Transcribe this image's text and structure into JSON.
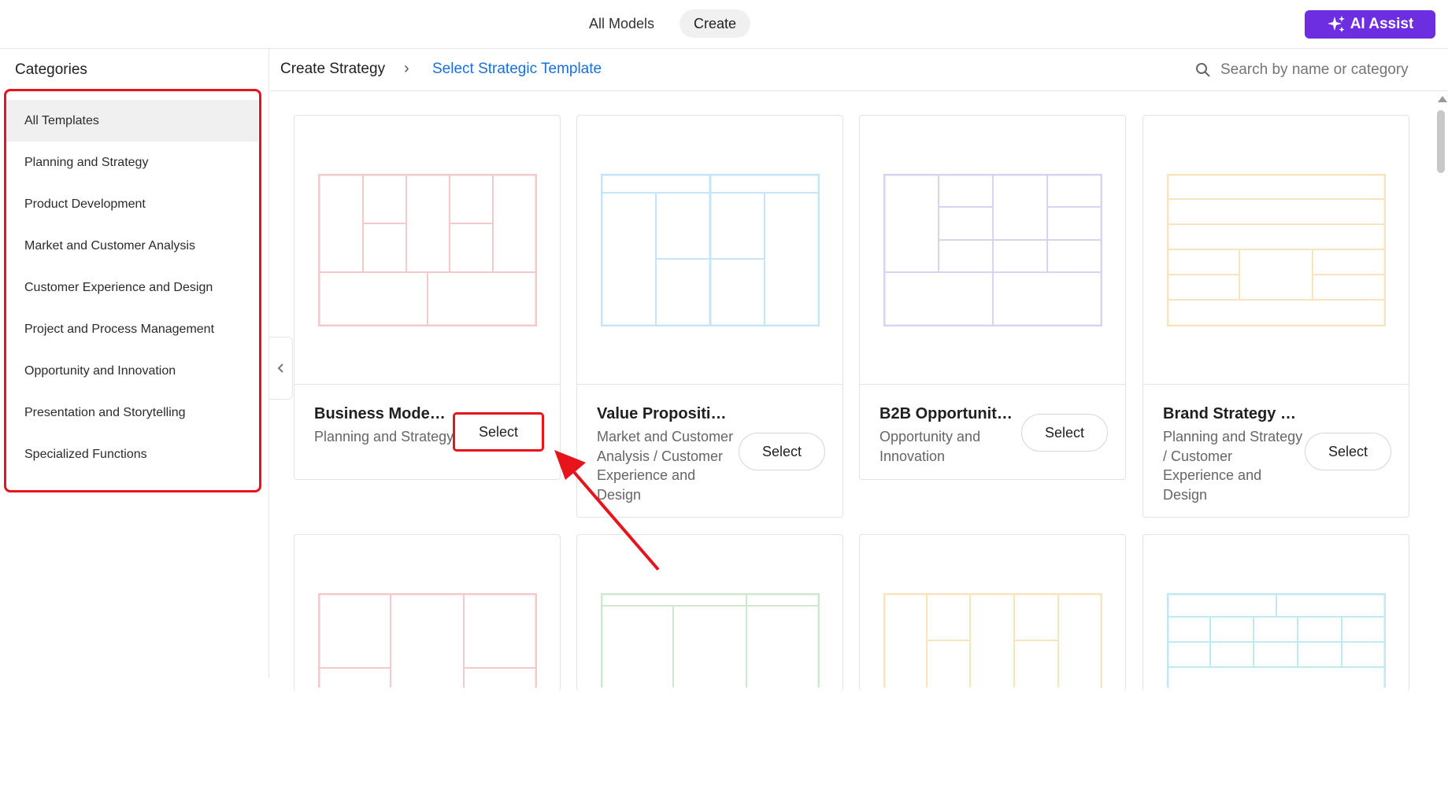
{
  "topnav": {
    "tabs": [
      {
        "label": "All Models"
      },
      {
        "label": "Create"
      }
    ],
    "ai_assist_label": "AI Assist"
  },
  "sidebar": {
    "title": "Categories",
    "items": [
      {
        "label": "All Templates"
      },
      {
        "label": "Planning and Strategy"
      },
      {
        "label": "Product Development"
      },
      {
        "label": "Market and Customer Analysis"
      },
      {
        "label": "Customer Experience and Design"
      },
      {
        "label": "Project and Process Management"
      },
      {
        "label": "Opportunity and Innovation"
      },
      {
        "label": "Presentation and Storytelling"
      },
      {
        "label": "Specialized Functions"
      }
    ]
  },
  "breadcrumb": {
    "root": "Create Strategy",
    "current": "Select Strategic Template"
  },
  "search": {
    "placeholder": "Search by name or category"
  },
  "templates": [
    {
      "title": "Business Model ...",
      "category": "Planning and Strategy",
      "select_label": "Select",
      "accent": "#f4c9c9"
    },
    {
      "title": "Value Propositio...",
      "category": "Market and Customer Analysis / Customer Experience and Design",
      "select_label": "Select",
      "accent": "#c6e6f7"
    },
    {
      "title": "B2B Opportunity ...",
      "category": "Opportunity and Innovation",
      "select_label": "Select",
      "accent": "#d9d3f2"
    },
    {
      "title": "Brand Strategy C...",
      "category": "Planning and Strategy / Customer Experience and Design",
      "select_label": "Select",
      "accent": "#f8e5bd"
    }
  ],
  "colors": {
    "ai_assist_bg": "#6c2ee0",
    "link_blue": "#1a6fe0",
    "highlight_red": "#e8141b"
  }
}
